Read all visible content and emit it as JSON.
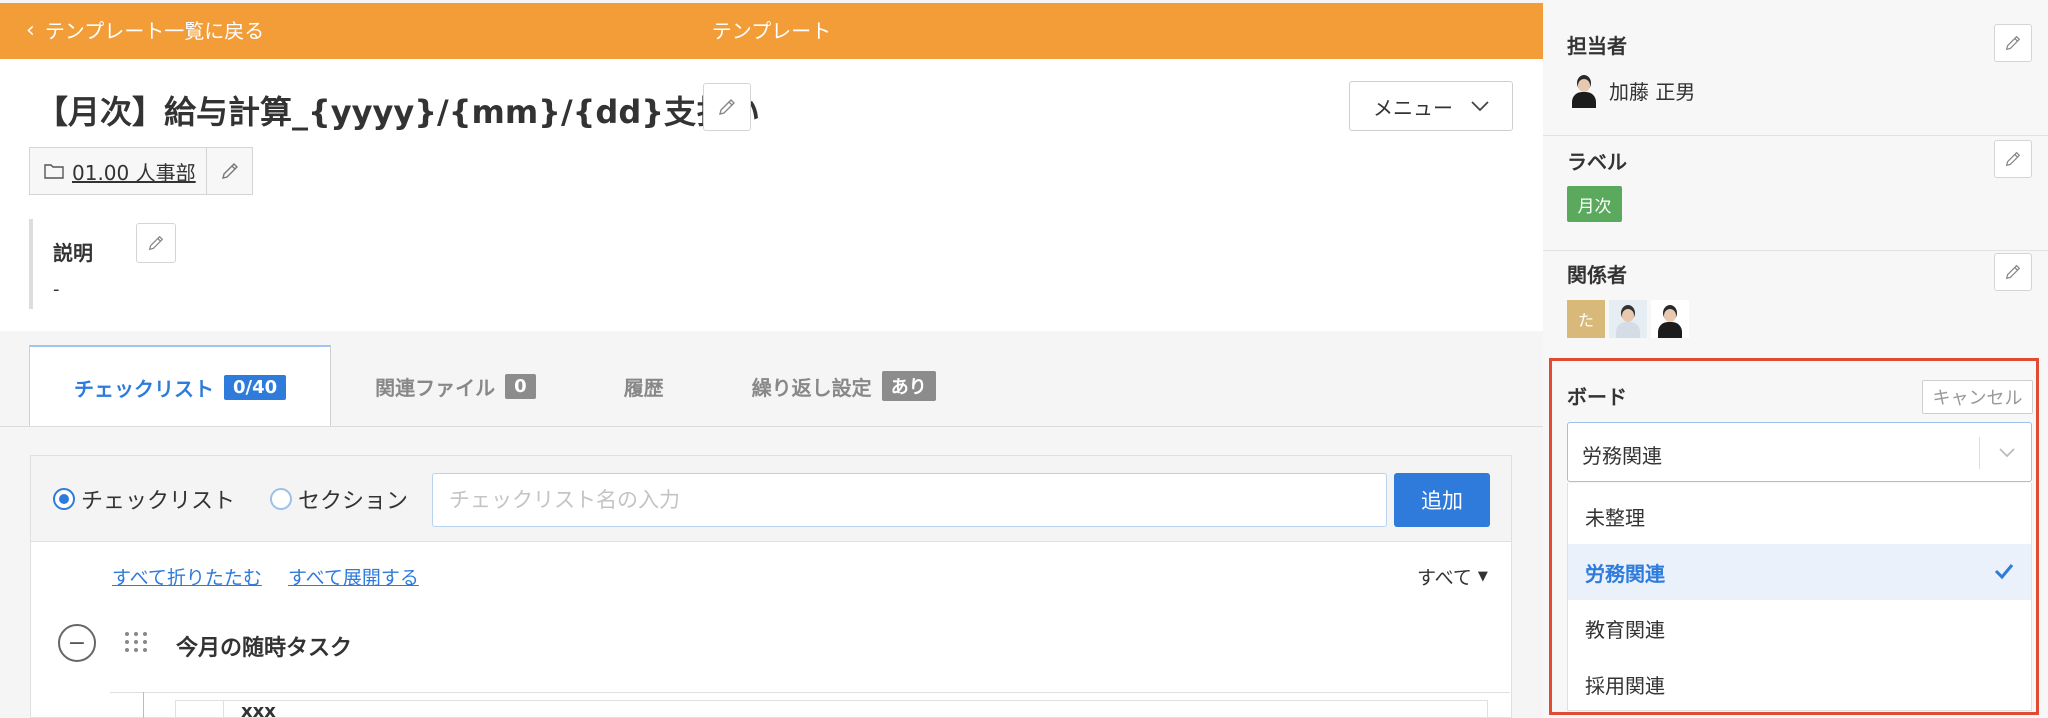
{
  "topbar": {
    "back_label": "テンプレート一覧に戻る",
    "title": "テンプレート",
    "color": "#f29d38"
  },
  "header": {
    "title": "【月次】給与計算_{yyyy}/{mm}/{dd}支払い",
    "menu_label": "メニュー",
    "folder_label": "01.00 人事部",
    "description_label": "説明",
    "description_value": "-"
  },
  "tabs": [
    {
      "label": "チェックリスト",
      "badge": "0/40",
      "active": true
    },
    {
      "label": "関連ファイル",
      "badge": "0",
      "active": false
    },
    {
      "label": "履歴",
      "badge": "",
      "active": false
    },
    {
      "label": "繰り返し設定",
      "badge": "あり",
      "active": false
    }
  ],
  "checklist": {
    "radio_checklist": "チェックリスト",
    "radio_section": "セクション",
    "input_placeholder": "チェックリスト名の入力",
    "input_value": "",
    "add_label": "追加",
    "collapse_all": "すべて折りたたむ",
    "expand_all": "すべて展開する",
    "filter_label": "すべて",
    "section_title": "今月の随時タスク",
    "task_text": "xxx"
  },
  "sidebar": {
    "assignee_label": "担当者",
    "assignee_name": "加藤 正男",
    "label_label": "ラベル",
    "label_chip": "月次",
    "label_chip_color": "#5aa95d",
    "members_label": "関係者",
    "member_initial": "た",
    "board": {
      "label": "ボード",
      "cancel_label": "キャンセル",
      "selected": "労務関連",
      "options": [
        {
          "label": "未整理",
          "selected": false
        },
        {
          "label": "労務関連",
          "selected": true
        },
        {
          "label": "教育関連",
          "selected": false
        },
        {
          "label": "採用関連",
          "selected": false
        }
      ],
      "highlight_color": "#e14b33"
    }
  },
  "accent_color": "#2e7bdc"
}
